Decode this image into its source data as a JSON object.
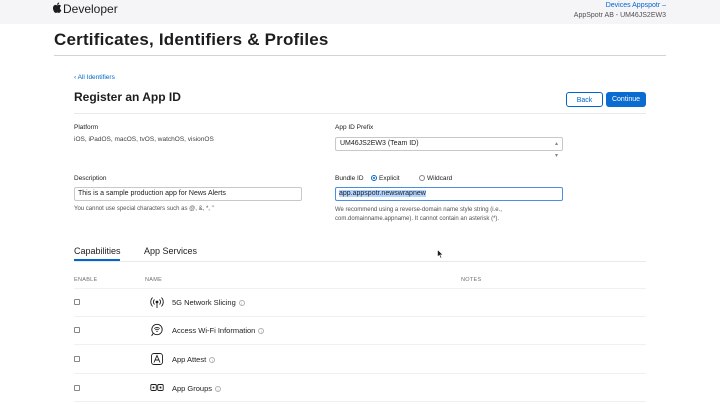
{
  "brand": {
    "logo": "apple-logo",
    "name": "Developer"
  },
  "account": {
    "link": "Devices Appspotr –",
    "team": "AppSpotr AB - UM46JS2EW3"
  },
  "page_title": "Certificates, Identifiers & Profiles",
  "back_link": "‹ All Identifiers",
  "section_title": "Register an App ID",
  "buttons": {
    "back": "Back",
    "continue": "Continue"
  },
  "platform": {
    "label": "Platform",
    "value": "iOS, iPadOS, macOS, tvOS, watchOS, visionOS"
  },
  "prefix": {
    "label": "App ID Prefix",
    "value": "UM46JS2EW3 (Team ID)"
  },
  "description": {
    "label": "Description",
    "value": "This is a sample production app for News Alerts",
    "hint": "You cannot use special characters such as @, &, *, \""
  },
  "bundle": {
    "label": "Bundle ID",
    "explicit": "Explicit",
    "wildcard": "Wildcard",
    "value": "app.appspotr.newswrapnew",
    "hint1": "We recommend using a reverse-domain name style string (i.e.,",
    "hint2": "com.domainname.appname). It cannot contain an asterisk (*)."
  },
  "tabs": {
    "capabilities": "Capabilities",
    "services": "App Services"
  },
  "columns": {
    "enable": "ENABLE",
    "name": "NAME",
    "notes": "NOTES"
  },
  "capabilities": [
    {
      "name": "5G Network Slicing",
      "icon": "network-slicing-icon"
    },
    {
      "name": "Access Wi-Fi Information",
      "icon": "wifi-info-icon"
    },
    {
      "name": "App Attest",
      "icon": "app-attest-icon"
    },
    {
      "name": "App Groups",
      "icon": "app-groups-icon"
    }
  ],
  "info_glyph": "i",
  "colors": {
    "accent": "#0066cc",
    "topbar": "#f5f5f7",
    "selection": "#b4d5fe"
  }
}
